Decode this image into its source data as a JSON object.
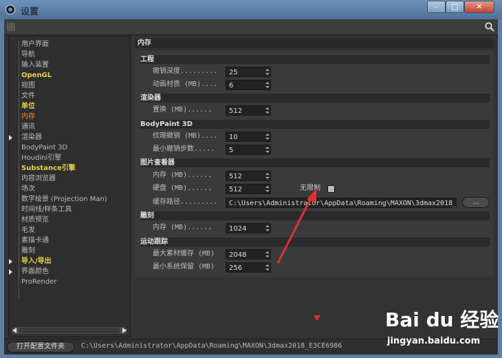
{
  "window": {
    "title": "设置"
  },
  "nav": {
    "items": [
      {
        "label": "用户界面",
        "style": "normal"
      },
      {
        "label": "导航",
        "style": "normal"
      },
      {
        "label": "输入装置",
        "style": "normal"
      },
      {
        "label": "OpenGL",
        "style": "yellow"
      },
      {
        "label": "视图",
        "style": "normal"
      },
      {
        "label": "文件",
        "style": "normal"
      },
      {
        "label": "单位",
        "style": "yellow"
      },
      {
        "label": "内存",
        "style": "selected"
      },
      {
        "label": "通讯",
        "style": "normal"
      },
      {
        "label": "渲染器",
        "style": "normal",
        "expand": true
      },
      {
        "label": "BodyPaint 3D",
        "style": "normal"
      },
      {
        "label": "Houdini引擎",
        "style": "normal"
      },
      {
        "label": "Substance引擎",
        "style": "yellow"
      },
      {
        "label": "内容浏览器",
        "style": "normal"
      },
      {
        "label": "场次",
        "style": "normal"
      },
      {
        "label": "数字绘景 (Projection Man)",
        "style": "normal"
      },
      {
        "label": "时间线/样条工具",
        "style": "normal"
      },
      {
        "label": "材质预览",
        "style": "normal"
      },
      {
        "label": "毛发",
        "style": "normal"
      },
      {
        "label": "素描卡通",
        "style": "normal"
      },
      {
        "label": "雕刻",
        "style": "normal"
      },
      {
        "label": "导入/导出",
        "style": "yellow",
        "expand": true
      },
      {
        "label": "界面颜色",
        "style": "normal",
        "expand": true
      },
      {
        "label": "ProRender",
        "style": "normal"
      }
    ]
  },
  "content": {
    "section_title": "内存",
    "groups": {
      "project": {
        "title": "工程",
        "undo_depth": {
          "label": "撤销深度.........",
          "value": "25"
        },
        "anim_material": {
          "label": "动画材质 (MB)....",
          "value": "6"
        }
      },
      "renderer": {
        "title": "渲染器",
        "swap": {
          "label": "置换 (MB)......",
          "value": "512"
        }
      },
      "bodypaint": {
        "title": "BodyPaint 3D",
        "texture_undo": {
          "label": "纹理撤销 (MB)....",
          "value": "10"
        },
        "min_undo": {
          "label": "最小撤销步数.....",
          "value": "5"
        }
      },
      "picture_viewer": {
        "title": "图片查看器",
        "memory": {
          "label": "内存 (MB)......",
          "value": "512"
        },
        "disk": {
          "label": "硬盘 (MB)......",
          "value": "512"
        },
        "unlimited_label": "无限制",
        "cache_path": {
          "label": "缓存路径.........",
          "value": "C:\\Users\\Administrator\\AppData\\Roaming\\MAXON\\3dmax2018_"
        },
        "browse_label": "..."
      },
      "sculpt": {
        "title": "雕刻",
        "memory": {
          "label": "内存 (MB)......",
          "value": "1024"
        }
      },
      "motion_tracking": {
        "title": "运动跟踪",
        "max_asset_cache": {
          "label": "最大素材缓存 (MB)",
          "value": "2048"
        },
        "min_system_reserve": {
          "label": "最小系统保留 (MB)",
          "value": "256"
        }
      }
    }
  },
  "footer": {
    "open_folder_label": "打开配置文件夹",
    "path": "C:\\Users\\Administrator\\AppData\\Roaming\\MAXON\\3dmax2018_E3CE6986"
  },
  "watermark": {
    "brand": "Bai du 经验",
    "url": "jingyan.baidu.com"
  },
  "colors": {
    "selected": "#e89030",
    "highlight": "#e8d04a",
    "annotation": "#e23030"
  }
}
